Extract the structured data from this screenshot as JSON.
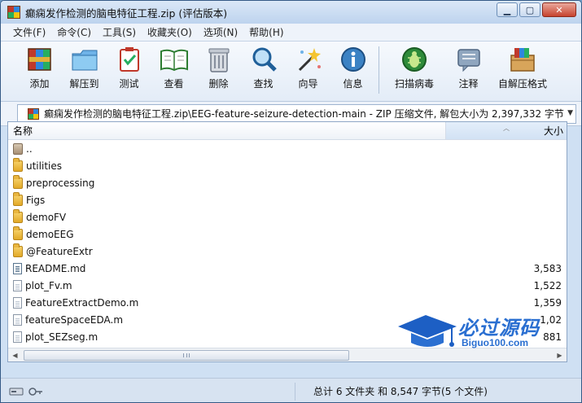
{
  "window": {
    "title": "癫痫发作检测的脑电特征工程.zip (评估版本)",
    "controls": {
      "minimize": "▁",
      "maximize": "▢",
      "close": "✕"
    }
  },
  "menu": [
    "文件(F)",
    "命令(C)",
    "工具(S)",
    "收藏夹(O)",
    "选项(N)",
    "帮助(H)"
  ],
  "toolbar": [
    {
      "label": "添加",
      "icon": "add-archive-icon"
    },
    {
      "label": "解压到",
      "icon": "extract-to-icon"
    },
    {
      "label": "测试",
      "icon": "test-icon"
    },
    {
      "label": "查看",
      "icon": "view-book-icon"
    },
    {
      "label": "删除",
      "icon": "delete-bin-icon"
    },
    {
      "label": "查找",
      "icon": "find-magnifier-icon"
    },
    {
      "label": "向导",
      "icon": "wizard-wand-icon"
    },
    {
      "label": "信息",
      "icon": "info-icon"
    },
    {
      "label": "扫描病毒",
      "icon": "virus-scan-icon"
    },
    {
      "label": "注释",
      "icon": "comment-icon"
    },
    {
      "label": "自解压格式",
      "icon": "sfx-box-icon"
    }
  ],
  "address": {
    "path": "癫痫发作检测的脑电特征工程.zip\\EEG-feature-seizure-detection-main - ZIP 压缩文件, 解包大小为 2,397,332 字节"
  },
  "list": {
    "columns": {
      "name": "名称",
      "size": "大小"
    },
    "rows": [
      {
        "name": "..",
        "type": "up",
        "size": ""
      },
      {
        "name": "utilities",
        "type": "folder",
        "size": ""
      },
      {
        "name": "preprocessing",
        "type": "folder",
        "size": ""
      },
      {
        "name": "Figs",
        "type": "folder",
        "size": ""
      },
      {
        "name": "demoFV",
        "type": "folder",
        "size": ""
      },
      {
        "name": "demoEEG",
        "type": "folder",
        "size": ""
      },
      {
        "name": "@FeatureExtr",
        "type": "folder",
        "size": ""
      },
      {
        "name": "README.md",
        "type": "doc",
        "size": "3,583"
      },
      {
        "name": "plot_Fv.m",
        "type": "file",
        "size": "1,522"
      },
      {
        "name": "FeatureExtractDemo.m",
        "type": "file",
        "size": "1,359"
      },
      {
        "name": "featureSpaceEDA.m",
        "type": "file",
        "size": "1,02"
      },
      {
        "name": "plot_SEZseg.m",
        "type": "file",
        "size": "881"
      }
    ]
  },
  "watermark": {
    "text": "必过源码",
    "url": "Biguo100.com"
  },
  "status": {
    "summary": "总计 6 文件夹 和 8,547 字节(5 个文件)"
  },
  "colors": {
    "accent": "#2a6fd1",
    "titlebar": "#bdd3ee",
    "list_bg": "#ffffff"
  }
}
